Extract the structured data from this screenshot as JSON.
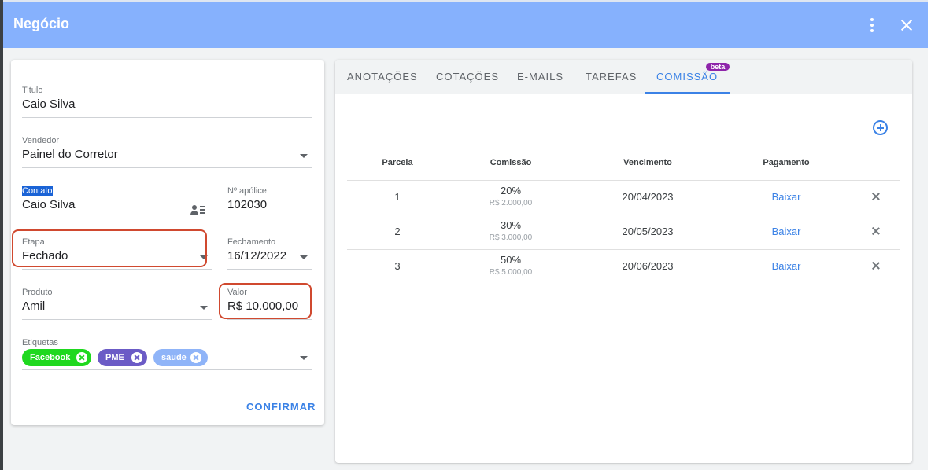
{
  "dialog": {
    "title": "Negócio"
  },
  "form": {
    "titulo": {
      "label": "Titulo",
      "value": "Caio Silva"
    },
    "vendedor": {
      "label": "Vendedor",
      "value": "Painel do Corretor"
    },
    "contato": {
      "label": "Contato",
      "value": "Caio Silva"
    },
    "apolice": {
      "label": "Nº apólice",
      "value": "102030"
    },
    "etapa": {
      "label": "Etapa",
      "value": "Fechado"
    },
    "fechamento": {
      "label": "Fechamento",
      "value": "16/12/2022"
    },
    "produto": {
      "label": "Produto",
      "value": "Amil"
    },
    "valor": {
      "label": "Valor",
      "value": "R$ 10.000,00"
    },
    "etiquetas": {
      "label": "Etiquetas",
      "chips": [
        {
          "label": "Facebook",
          "color": "#1fd81f"
        },
        {
          "label": "PME",
          "color": "#6b5bc6"
        },
        {
          "label": "saude",
          "color": "#8fb4f8"
        }
      ]
    },
    "confirm_label": "CONFIRMAR"
  },
  "tabs": [
    {
      "label": "ANOTAÇÕES",
      "active": false
    },
    {
      "label": "COTAÇÕES",
      "active": false
    },
    {
      "label": "E-MAILS",
      "active": false
    },
    {
      "label": "TAREFAS",
      "active": false
    },
    {
      "label": "COMISSÃO",
      "active": true,
      "badge": "beta"
    }
  ],
  "commission": {
    "headers": [
      "Parcela",
      "Comissão",
      "Vencimento",
      "Pagamento"
    ],
    "rows": [
      {
        "parcela": "1",
        "percent": "20%",
        "amount": "R$ 2.000,00",
        "vencimento": "20/04/2023",
        "pagamento": "Baixar"
      },
      {
        "parcela": "2",
        "percent": "30%",
        "amount": "R$ 3.000,00",
        "vencimento": "20/05/2023",
        "pagamento": "Baixar"
      },
      {
        "parcela": "3",
        "percent": "50%",
        "amount": "R$ 5.000,00",
        "vencimento": "20/06/2023",
        "pagamento": "Baixar"
      }
    ]
  },
  "colors": {
    "header": "#86b1fd",
    "accent": "#3b82e6",
    "highlight": "#d0492f",
    "beta": "#8e24aa"
  },
  "icons": [
    "more-vert-icon",
    "close-icon",
    "contact-card-icon",
    "add-circle-icon",
    "remove-icon",
    "caret-down-icon",
    "chip-close-icon"
  ]
}
